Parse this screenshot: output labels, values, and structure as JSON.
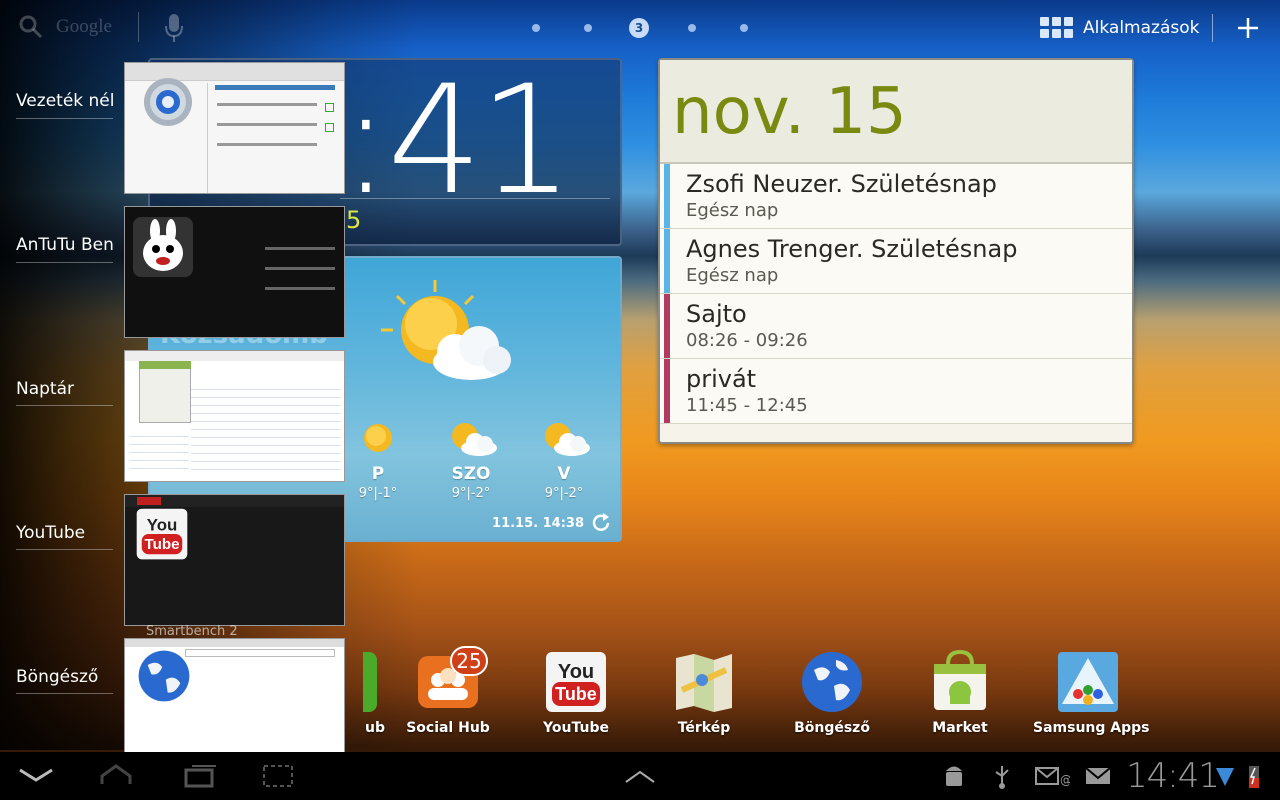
{
  "search": {
    "placeholder": "Google"
  },
  "home": {
    "current_page": "3"
  },
  "apps_button": {
    "label": "Alkalmazások"
  },
  "clock": {
    "time": "14:41",
    "time_visible": ":41",
    "sub_visible": "5"
  },
  "weather": {
    "city_partial": "Kozsadomb",
    "forecast": [
      {
        "day": "P",
        "temp": "9°|-1°"
      },
      {
        "day": "SZO",
        "temp": "9°|-2°"
      },
      {
        "day": "V",
        "temp": "9°|-2°"
      }
    ],
    "updated": "11.15. 14:38"
  },
  "calendar": {
    "date": "nov. 15",
    "events": [
      {
        "title": "Zsofi Neuzer. Születésnap",
        "sub": "Egész nap",
        "color": "#5ab4e6"
      },
      {
        "title": "Agnes Trenger. Születésnap",
        "sub": "Egész nap",
        "color": "#5ab4e6"
      },
      {
        "title": "Sajto",
        "sub": "08:26 - 09:26",
        "color": "#b03a60"
      },
      {
        "title": "privát",
        "sub": "11:45 - 12:45",
        "color": "#b03a60"
      }
    ]
  },
  "recent_apps": [
    {
      "label": "Vezeték nél"
    },
    {
      "label": "AnTuTu Ben"
    },
    {
      "label": "Naptár"
    },
    {
      "label": "YouTube"
    },
    {
      "label": "Böngésző"
    }
  ],
  "smartbench": "Smartbench 2",
  "dock": [
    {
      "label": "ub"
    },
    {
      "label": "Social Hub",
      "badge": "25"
    },
    {
      "label": "YouTube"
    },
    {
      "label": "Térkép"
    },
    {
      "label": "Böngésző"
    },
    {
      "label": "Market"
    },
    {
      "label": "Samsung Apps"
    }
  ],
  "status": {
    "time": "14:41"
  },
  "colors": {
    "calendar_date": "#7a8a10",
    "badge": "#d04018"
  }
}
